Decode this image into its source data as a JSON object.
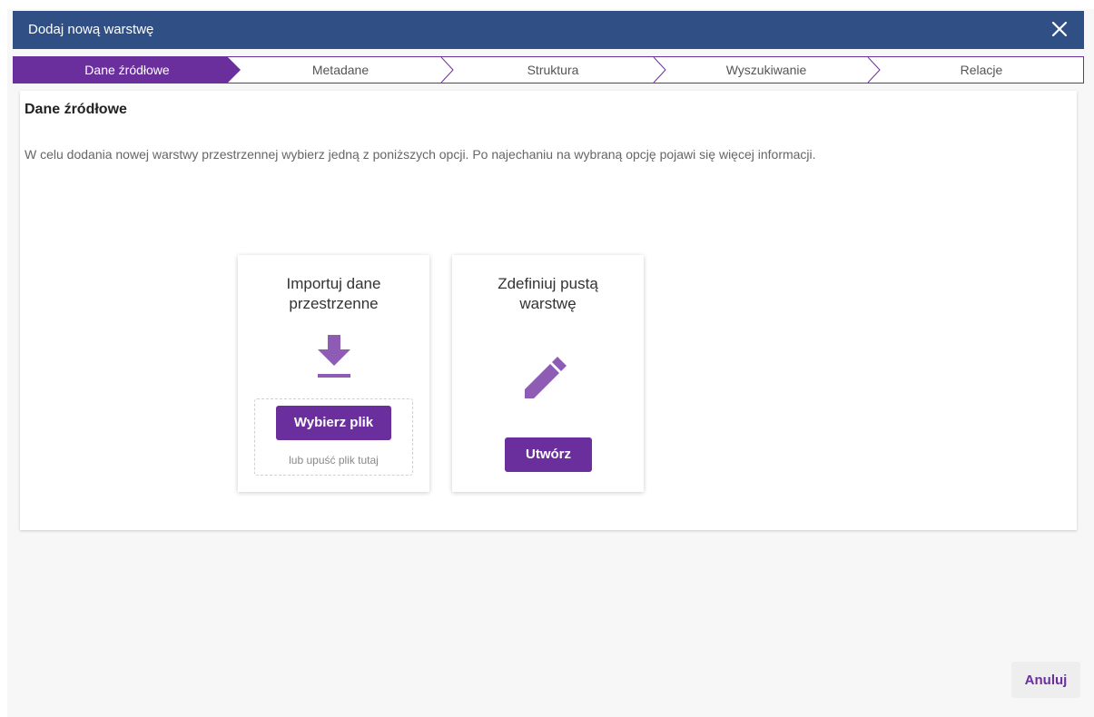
{
  "dialog": {
    "title": "Dodaj nową warstwę",
    "close_icon": "close-icon"
  },
  "stepper": {
    "steps": [
      {
        "label": "Dane źródłowe",
        "active": true
      },
      {
        "label": "Metadane",
        "active": false
      },
      {
        "label": "Struktura",
        "active": false
      },
      {
        "label": "Wyszukiwanie",
        "active": false
      },
      {
        "label": "Relacje",
        "active": false
      }
    ]
  },
  "panel": {
    "heading": "Dane źródłowe",
    "description": "W celu dodania nowej warstwy przestrzennej wybierz jedną z poniższych opcji. Po najechaniu na wybraną opcję pojawi się więcej informacji."
  },
  "cards": {
    "import": {
      "title_line1": "Importuj dane",
      "title_line2": "przestrzenne",
      "icon": "download-icon",
      "button": "Wybierz plik",
      "hint": "lub upuść plik tutaj"
    },
    "define": {
      "title_line1": "Zdefiniuj pustą",
      "title_line2": "warstwę",
      "icon": "pencil-icon",
      "button": "Utwórz"
    }
  },
  "footer": {
    "cancel": "Anuluj"
  },
  "colors": {
    "header_bg": "#2f4f85",
    "accent": "#6a2f9d",
    "icon": "#8e5bb5"
  }
}
